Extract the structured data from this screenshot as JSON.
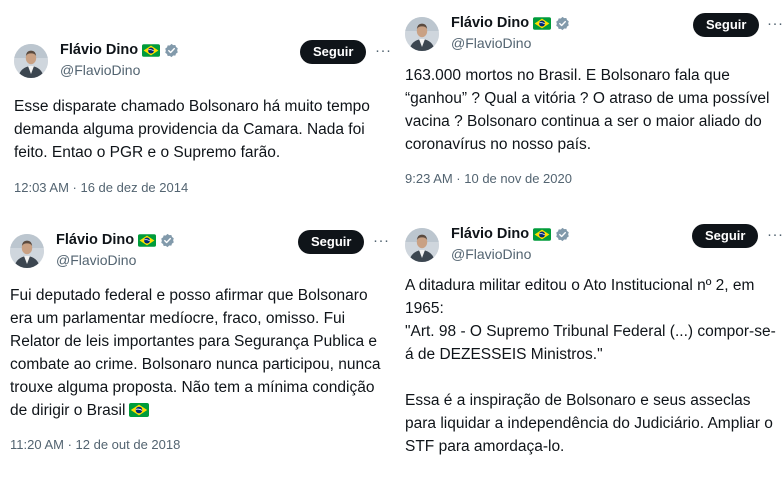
{
  "tweets": [
    {
      "author": "Flávio Dino",
      "handle": "@FlavioDino",
      "follow_label": "Seguir",
      "more_label": "···",
      "text": "Esse disparate chamado Bolsonaro há muito tempo demanda alguma providencia da Camara. Nada foi feito. Entao o PGR e o Supremo farão.",
      "timestamp": "12:03 AM · 16 de dez de 2014"
    },
    {
      "author": "Flávio Dino",
      "handle": "@FlavioDino",
      "follow_label": "Seguir",
      "more_label": "···",
      "text": "163.000 mortos no Brasil. E Bolsonaro fala que “ganhou” ? Qual a vitória ? O atraso de uma possível vacina ? Bolsonaro continua a ser o maior aliado do coronavírus no nosso país.",
      "timestamp": "9:23 AM · 10 de nov de 2020"
    },
    {
      "author": "Flávio Dino",
      "handle": "@FlavioDino",
      "follow_label": "Seguir",
      "more_label": "···",
      "text": "Fui deputado federal e posso afirmar que Bolsonaro era um parlamentar medíocre, fraco, omisso. Fui Relator de leis importantes para Segurança Publica e combate ao crime. Bolsonaro nunca participou, nunca trouxe alguma proposta. Não tem a mínima condição de dirigir o Brasil",
      "timestamp": "11:20 AM · 12 de out de 2018"
    },
    {
      "author": "Flávio Dino",
      "handle": "@FlavioDino",
      "follow_label": "Seguir",
      "more_label": "···",
      "text": "A ditadura militar editou o Ato Institucional nº 2, em 1965:\n\"Art. 98 - O Supremo Tribunal Federal (...) compor-se-á de DEZESSEIS Ministros.\"\n\nEssa é a inspiração de Bolsonaro e seus asseclas para liquidar a independência do Judiciário. Ampliar o STF para amordaça-lo.",
      "timestamp": ""
    }
  ],
  "colors": {
    "text": "#0f1419",
    "secondary": "#536471",
    "follow_button_bg": "#0f1419",
    "follow_button_text": "#ffffff",
    "verified_badge": "#829aab",
    "flag_green": "#009c3b",
    "flag_yellow": "#ffdf00",
    "flag_blue": "#002776"
  },
  "icons": {
    "verified": "verified-badge-icon",
    "flag": "brazil-flag-icon",
    "more": "more-options-icon"
  }
}
